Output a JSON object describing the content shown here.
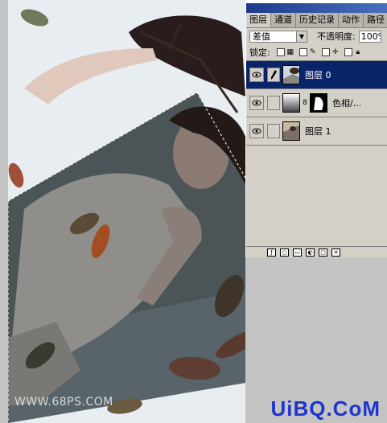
{
  "tabs": [
    {
      "label": "图层",
      "active": true
    },
    {
      "label": "通道",
      "active": false
    },
    {
      "label": "历史记录",
      "active": false
    },
    {
      "label": "动作",
      "active": false
    },
    {
      "label": "路径",
      "active": false
    }
  ],
  "options": {
    "blend_mode": "差值",
    "opacity_label": "不透明度:",
    "opacity_value": "100%"
  },
  "lock": {
    "label": "锁定:"
  },
  "layers": [
    {
      "name": "图层 0",
      "selected": true
    },
    {
      "name": "色相/...",
      "selected": false
    },
    {
      "name": "图层 1",
      "selected": false
    }
  ],
  "watermark": {
    "left": "WWW.68PS.COM",
    "right": "UiBQ.CoM"
  },
  "colors": {
    "selected_layer": "#0a246a",
    "palette_bg": "#d4d0c8",
    "brand_blue": "#1e35d0"
  }
}
